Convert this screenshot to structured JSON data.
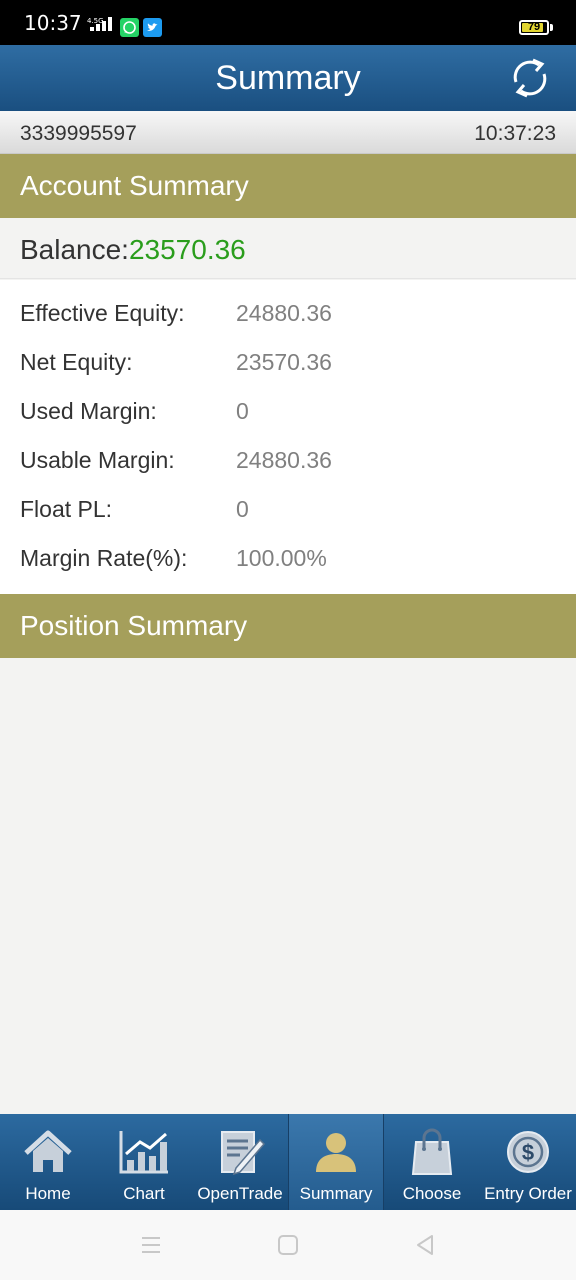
{
  "status_bar": {
    "time": "10:37",
    "network_tag": "4.5G",
    "apps": [
      "whatsapp-icon",
      "twitter-icon"
    ],
    "battery": "79",
    "battery_level": 0.79
  },
  "header": {
    "title": "Summary",
    "refresh_icon": "refresh-icon"
  },
  "info_bar": {
    "account_number": "3339995597",
    "time": "10:37:23"
  },
  "account_summary": {
    "heading": "Account Summary",
    "balance_label": "Balance:",
    "balance_value": "23570.36",
    "rows": [
      {
        "label": "Effective Equity:",
        "value": "24880.36"
      },
      {
        "label": "Net Equity:",
        "value": "23570.36"
      },
      {
        "label": "Used Margin:",
        "value": "0"
      },
      {
        "label": "Usable Margin:",
        "value": "24880.36"
      },
      {
        "label": "Float PL:",
        "value": "0"
      },
      {
        "label": "Margin Rate(%):",
        "value": "100.00%"
      }
    ]
  },
  "position_summary": {
    "heading": "Position Summary"
  },
  "tabs": [
    {
      "label": "Home",
      "icon": "home-icon"
    },
    {
      "label": "Chart",
      "icon": "chart-icon"
    },
    {
      "label": "OpenTrade",
      "icon": "edit-icon"
    },
    {
      "label": "Summary",
      "icon": "person-icon",
      "active": true
    },
    {
      "label": "Choose",
      "icon": "bag-icon"
    },
    {
      "label": "Entry Order",
      "icon": "dollar-coin-icon"
    }
  ],
  "colors": {
    "title_bar": "#1f5a8e",
    "section_header": "#a59f5b",
    "balance_value": "#2a9d1c",
    "active_icon": "#d8c27a"
  }
}
